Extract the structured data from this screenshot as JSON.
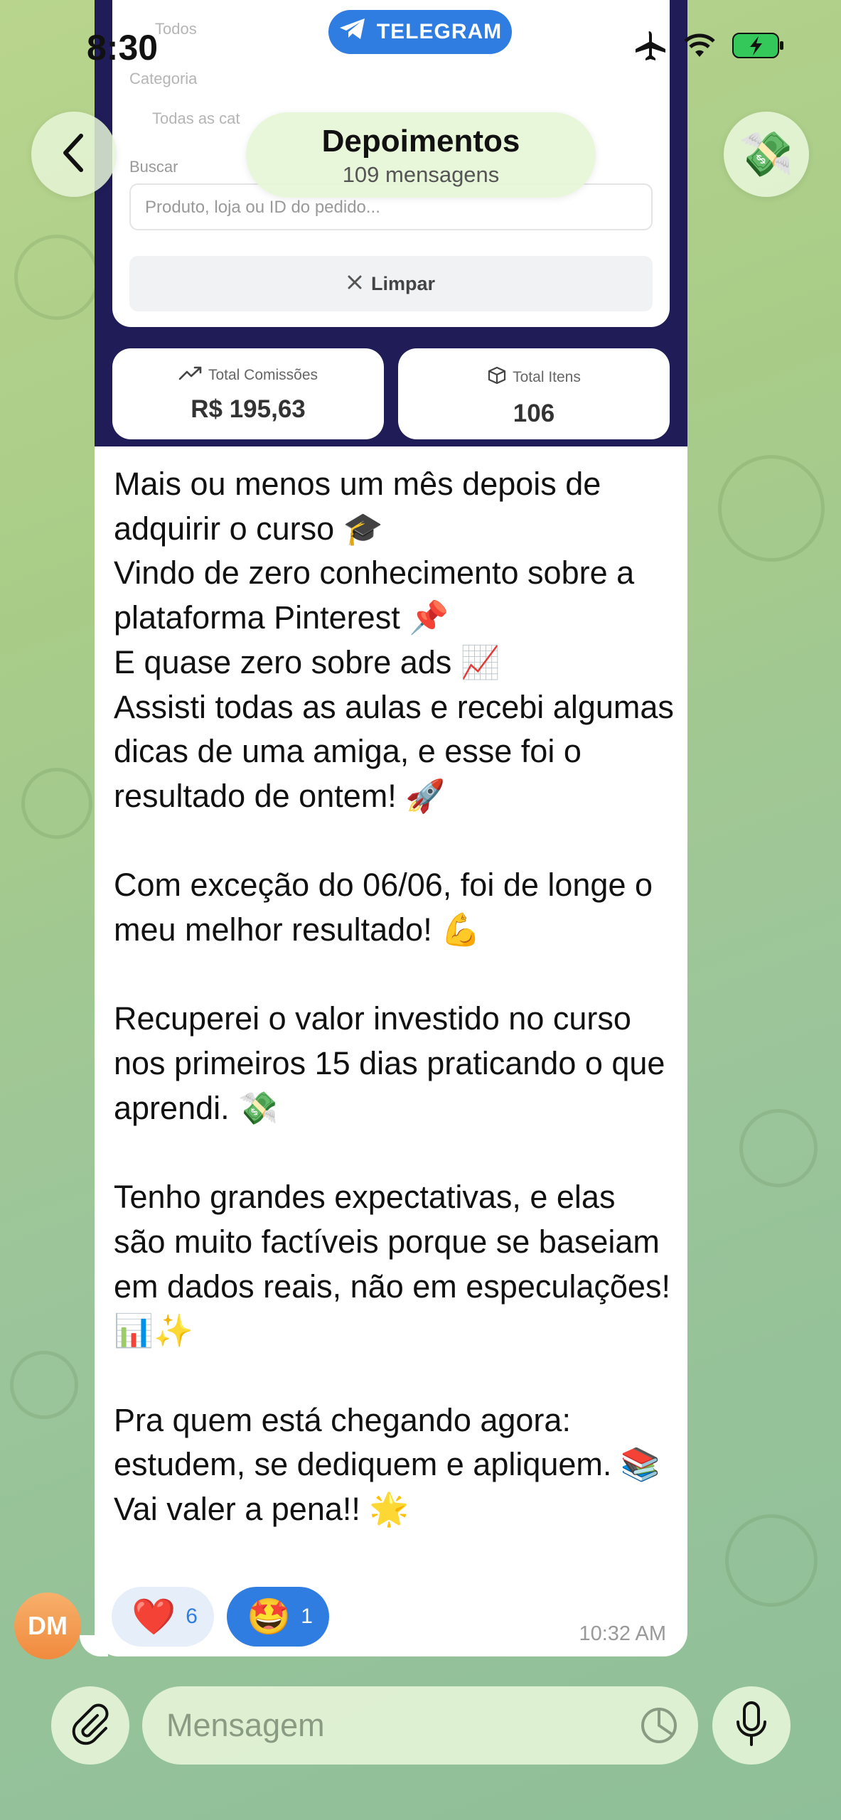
{
  "status_bar": {
    "time": "8:30",
    "app_pill": "TELEGRAM"
  },
  "header": {
    "title": "Depoimentos",
    "subtitle": "109 mensagens",
    "avatar_emoji": "💸"
  },
  "embedded_screenshot": {
    "faded_labels": [
      "Todos",
      "Categoria",
      "Todas as cat"
    ],
    "search_label": "Buscar",
    "search_placeholder": "Produto, loja ou ID do pedido...",
    "clear_button": "Limpar",
    "stats": [
      {
        "label": "Total Comissões",
        "value": "R$ 195,63"
      },
      {
        "label": "Total Itens",
        "value": "106"
      }
    ]
  },
  "message": {
    "text": "Mais ou menos um mês depois de adquirir o curso 🎓\nVindo de zero conhecimento sobre a plataforma Pinterest 📌\nE quase zero sobre ads 📈\nAssisti todas as aulas e recebi algumas dicas de uma amiga, e esse foi o resultado de ontem! 🚀\n\nCom exceção do 06/06, foi de longe o meu melhor resultado! 💪\n\nRecuperei o valor investido no curso nos primeiros 15 dias praticando o que aprendi. 💸\n\nTenho grandes expectativas, e elas são muito factíveis porque se baseiam em dados reais, não em especulações! 📊✨\n\nPra quem está chegando agora: estudem, se dediquem e apliquem. 📚\nVai valer a pena!! 🌟",
    "time": "10:32 AM",
    "reactions": [
      {
        "emoji": "❤️",
        "count": "6"
      },
      {
        "emoji": "🤩",
        "count": "1"
      }
    ],
    "sender_initials": "DM"
  },
  "composer": {
    "placeholder": "Mensagem"
  },
  "colors": {
    "accent": "#2f7de1",
    "bubble": "#ffffff",
    "avatar": "#f08a3e"
  }
}
